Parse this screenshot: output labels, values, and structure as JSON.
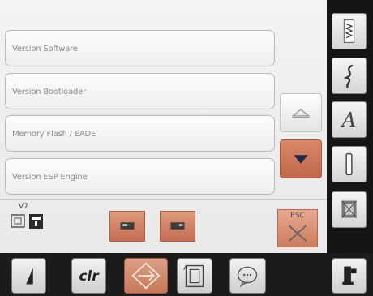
{
  "list": {
    "items": [
      {
        "label": "Version Software"
      },
      {
        "label": "Version Bootloader"
      },
      {
        "label": "Memory Flash / EADE"
      },
      {
        "label": "Version ESP Engine"
      }
    ]
  },
  "status": {
    "version": "V7"
  },
  "buttons": {
    "esc_label": "ESC"
  },
  "sidebar": {
    "items": [
      {
        "icon": "stitch-pattern-icon"
      },
      {
        "icon": "decorative-stitch-icon"
      },
      {
        "icon": "alphabet-icon",
        "glyph": "A"
      },
      {
        "icon": "buttonhole-icon"
      },
      {
        "icon": "quilt-icon"
      },
      {
        "icon": "presser-foot-icon"
      }
    ]
  },
  "bottom_bar": {
    "items": [
      {
        "icon": "stitch-length-icon"
      },
      {
        "icon": "clr-icon",
        "label": "clr"
      },
      {
        "icon": "navigation-icon",
        "active": true
      },
      {
        "icon": "setup-icon"
      },
      {
        "icon": "help-icon"
      }
    ]
  },
  "colors": {
    "accent": "#c77859",
    "background": "#efefef",
    "bar": "#1b1b1b"
  }
}
